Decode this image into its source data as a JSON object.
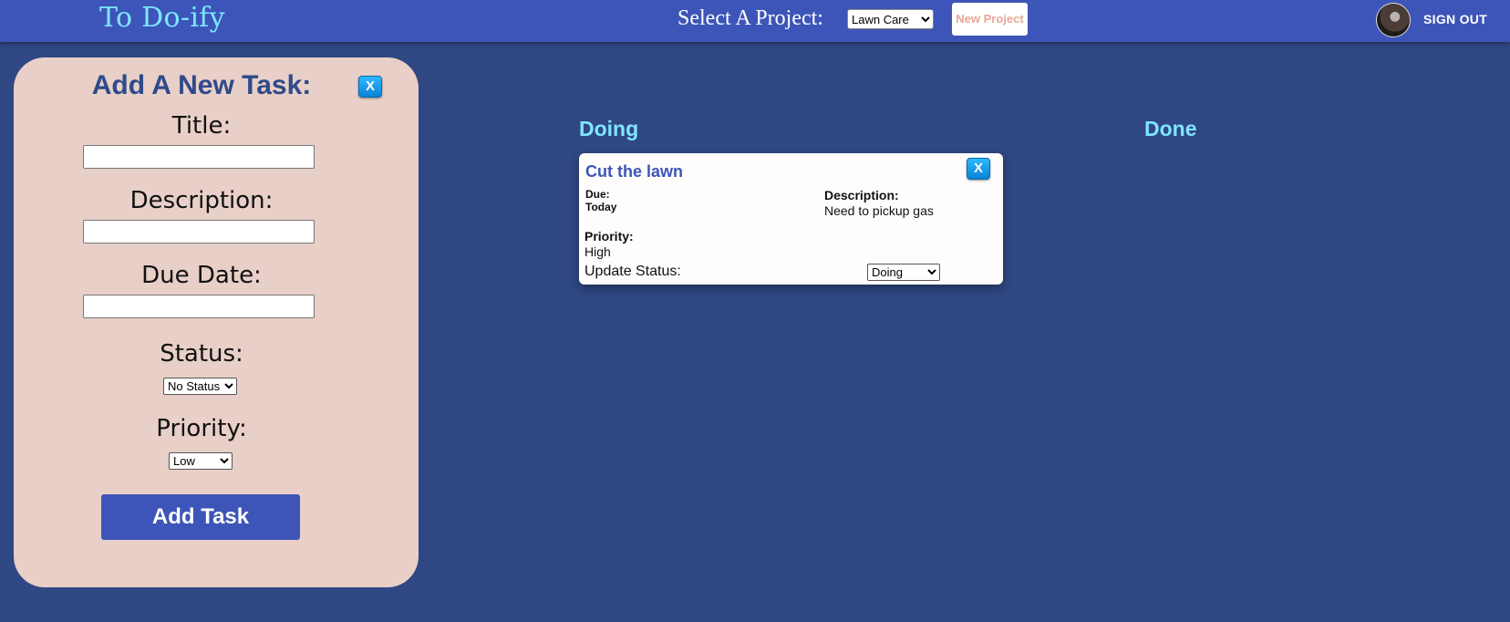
{
  "header": {
    "logo": "To Do-ify",
    "select_label": "Select A Project:",
    "project_selected": "Lawn Care",
    "new_project_label": "New Project",
    "sign_out_label": "SIGN OUT"
  },
  "add_task_panel": {
    "title": "Add A New Task:",
    "close_label": "X",
    "title_label": "Title:",
    "title_value": "",
    "description_label": "Description:",
    "description_value": "",
    "due_date_label": "Due Date:",
    "due_date_value": "",
    "status_label": "Status:",
    "status_selected": "No Status",
    "priority_label": "Priority:",
    "priority_selected": "Low",
    "submit_label": "Add Task"
  },
  "columns": {
    "doing": "Doing",
    "done": "Done"
  },
  "task_card": {
    "title": "Cut the lawn",
    "close_label": "X",
    "due_label": "Due:",
    "due_value": "Today",
    "description_label": "Description:",
    "description_value": "Need to pickup gas",
    "priority_label": "Priority:",
    "priority_value": "High",
    "update_status_label": "Update Status:",
    "status_selected": "Doing"
  },
  "colors": {
    "background": "#2f4783",
    "header": "#3d55b8",
    "accent_cyan": "#7fe6ff",
    "panel": "#e8cfc7",
    "new_project_text": "#e8a898",
    "close_button": "#0a82d6"
  }
}
